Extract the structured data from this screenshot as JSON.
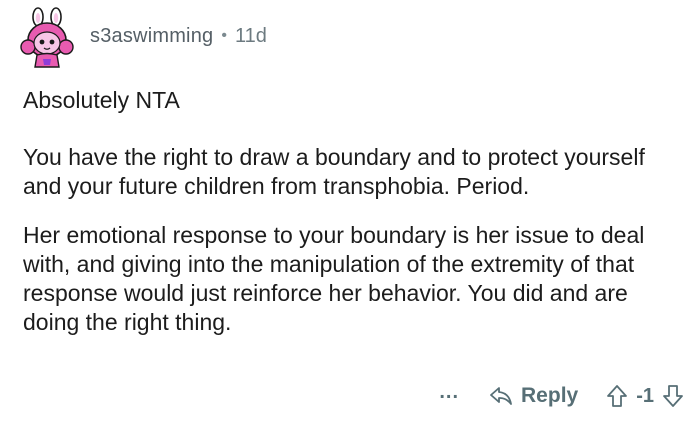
{
  "comment": {
    "author": {
      "username": "s3aswimming",
      "avatar_icon": "snoo-avatar-icon"
    },
    "separator": "•",
    "age": "11d",
    "paragraphs": [
      "Absolutely NTA",
      "You have the right to draw a boundary and to protect yourself and your future children from transphobia. Period.",
      "Her emotional response to your boundary is her issue to deal with, and giving into the manipulation of the extremity of that response would just reinforce her behavior. You did and are doing the right thing."
    ],
    "actions": {
      "more_label": "...",
      "reply_label": "Reply",
      "score": "-1",
      "upvote_icon": "upvote-arrow-icon",
      "downvote_icon": "downvote-arrow-icon",
      "reply_icon": "reply-arrow-icon"
    }
  },
  "colors": {
    "text": "#1c1c1c",
    "meta": "#576f76",
    "avatar_pink": "#e85bb0",
    "avatar_light": "#f7c6e6"
  }
}
